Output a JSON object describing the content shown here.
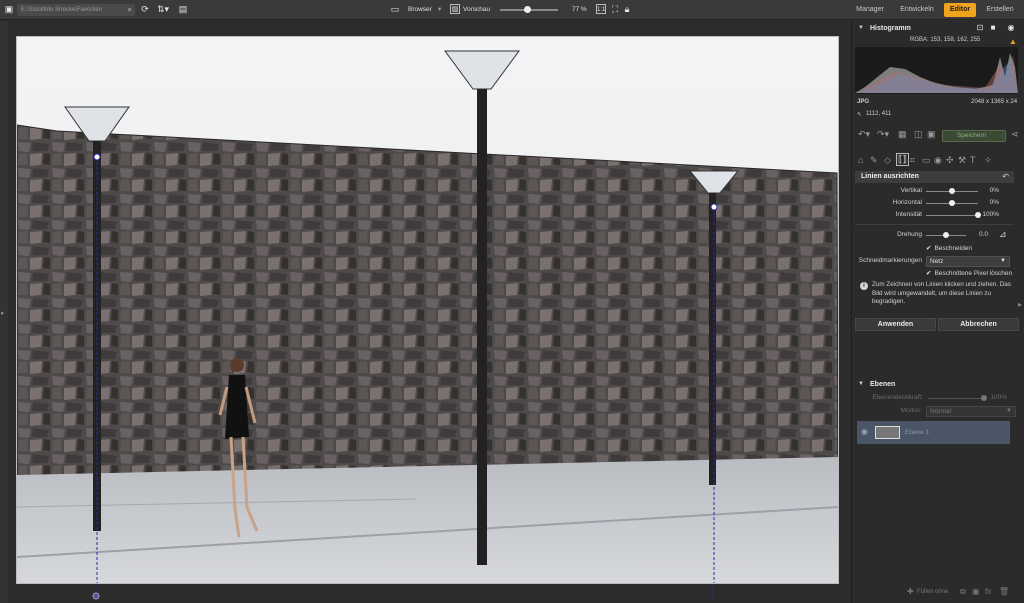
{
  "topbar": {
    "path_placeholder": "E:\\Stockfoto Strecke\\Favoriten",
    "browser_label": "Browser",
    "preview_label": "Vorschau",
    "zoom_value": "77 %",
    "zoom_level": 0.42,
    "tabs": [
      "Manager",
      "Entwickeln",
      "Editor",
      "Erstellen"
    ],
    "active_tab": "Editor"
  },
  "histogram": {
    "title": "Histogramm",
    "rgba": "RGBA: 153, 158, 162, 255",
    "format": "JPG",
    "dimensions": "2048 x 1365 x 24",
    "cursor_pos": "1112, 411"
  },
  "toolbar": {
    "save_label": "Speichern"
  },
  "lines": {
    "title": "Linien ausrichten",
    "vertical_label": "Vertikal",
    "vertical_value": "0%",
    "vertical_level": 0.5,
    "horizontal_label": "Horizontal",
    "horizontal_value": "0%",
    "horizontal_level": 0.5,
    "intensity_label": "Intensität",
    "intensity_value": "100%",
    "intensity_level": 1.0,
    "rotation_label": "Drehung",
    "rotation_value": "0.0",
    "rotation_level": 0.5,
    "crop_label": "Beschneiden",
    "crop_marks_label": "Schneidmarkierungen",
    "crop_marks_value": "Netz",
    "delete_cropped_label": "Beschnittene Pixel löschen",
    "info": "Zum Zeichnen von Linien klicken und ziehen. Das Bild wird umgewandelt, um diese Linien zu begradigen.",
    "apply_label": "Anwenden",
    "cancel_label": "Abbrechen"
  },
  "layers": {
    "title": "Ebenen",
    "opacity_label": "Ebenendeckkraft:",
    "opacity_value": "100%",
    "mode_label": "Modus:",
    "mode_value": "Normal",
    "layer_name": "Ebene 1",
    "new_layer_label": "Füllen ohne"
  },
  "colors": {
    "accent": "#f0a41c",
    "panel_bg": "#2b2b2b",
    "guide_line": "#2a2aa8"
  }
}
